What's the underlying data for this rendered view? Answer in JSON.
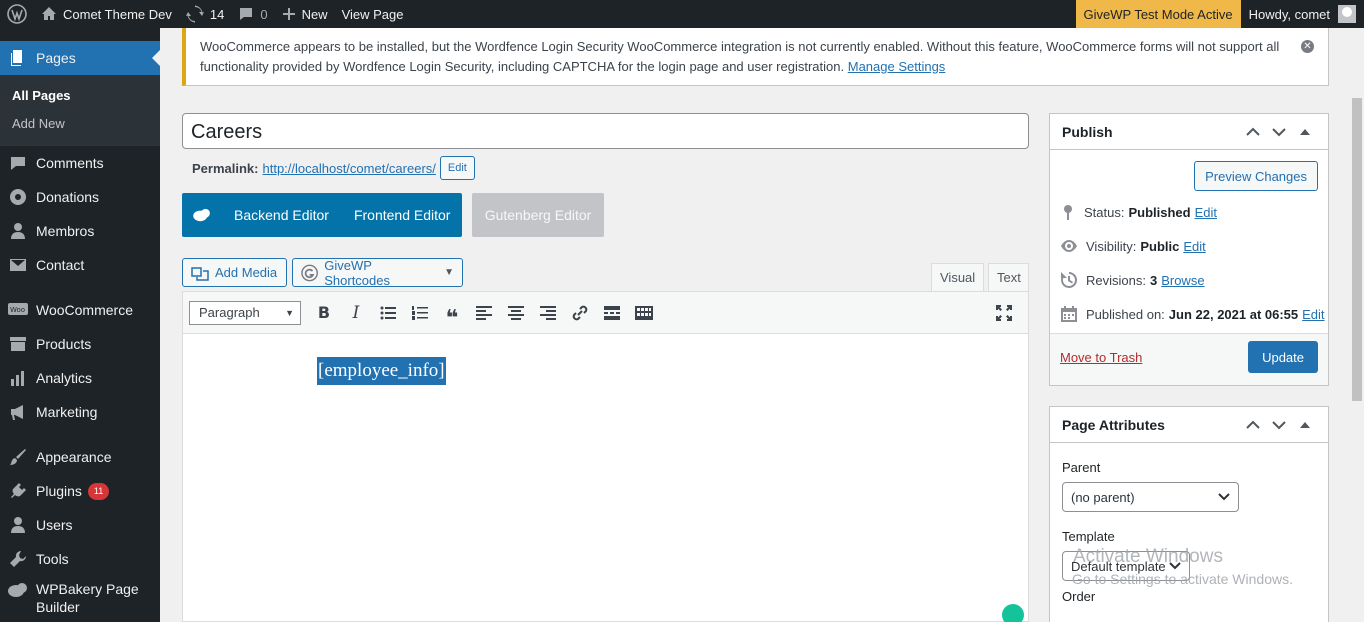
{
  "adminbar": {
    "site_name": "Comet Theme Dev",
    "updates_count": "14",
    "comments_count": "0",
    "new_label": "New",
    "view_page_label": "View Page",
    "givewp_label": "GiveWP Test Mode Active",
    "howdy_label": "Howdy, comet"
  },
  "sidebar": {
    "current": "Pages",
    "submenu": [
      "All Pages",
      "Add New"
    ],
    "items": [
      {
        "label": "Comments",
        "icon": "comments-icon"
      },
      {
        "label": "Donations",
        "icon": "donations-icon"
      },
      {
        "label": "Membros",
        "icon": "users-icon"
      },
      {
        "label": "Contact",
        "icon": "mail-icon"
      },
      {
        "label": "WooCommerce",
        "icon": "woocommerce-icon"
      },
      {
        "label": "Products",
        "icon": "archive-icon"
      },
      {
        "label": "Analytics",
        "icon": "chart-icon"
      },
      {
        "label": "Marketing",
        "icon": "megaphone-icon"
      },
      {
        "label": "Appearance",
        "icon": "brush-icon"
      },
      {
        "label": "Plugins",
        "icon": "plugin-icon",
        "badge": "11"
      },
      {
        "label": "Users",
        "icon": "users-icon"
      },
      {
        "label": "Tools",
        "icon": "wrench-icon"
      },
      {
        "label": "WPBakery Page Builder",
        "icon": "wpbakery-icon"
      }
    ]
  },
  "notice": {
    "text": "WooCommerce appears to be installed, but the Wordfence Login Security WooCommerce integration is not currently enabled. Without this feature, WooCommerce forms will not support all functionality provided by Wordfence Login Security, including CAPTCHA for the login page and user registration.",
    "link": "Manage Settings"
  },
  "editor": {
    "title": "Careers",
    "permalink_label": "Permalink:",
    "permalink_url": "http://localhost/comet/careers/",
    "permalink_edit": "Edit",
    "backend_editor": "Backend Editor",
    "frontend_editor": "Frontend Editor",
    "gutenberg_editor": "Gutenberg Editor",
    "add_media": "Add Media",
    "givewp_shortcodes": "GiveWP Shortcodes",
    "tab_visual": "Visual",
    "tab_text": "Text",
    "format_select": "Paragraph",
    "content": "[employee_info]"
  },
  "publish": {
    "title": "Publish",
    "preview": "Preview Changes",
    "status_label": "Status:",
    "status_value": "Published",
    "visibility_label": "Visibility:",
    "visibility_value": "Public",
    "revisions_label": "Revisions:",
    "revisions_value": "3",
    "browse": "Browse",
    "published_label": "Published on:",
    "published_value": "Jun 22, 2021 at 06:55",
    "edit": "Edit",
    "trash": "Move to Trash",
    "update": "Update"
  },
  "attributes": {
    "title": "Page Attributes",
    "parent_label": "Parent",
    "parent_value": "(no parent)",
    "template_label": "Template",
    "template_value": "Default template",
    "order_label": "Order"
  },
  "watermark": {
    "line1": "Activate Windows",
    "line2": "Go to Settings to activate Windows."
  }
}
